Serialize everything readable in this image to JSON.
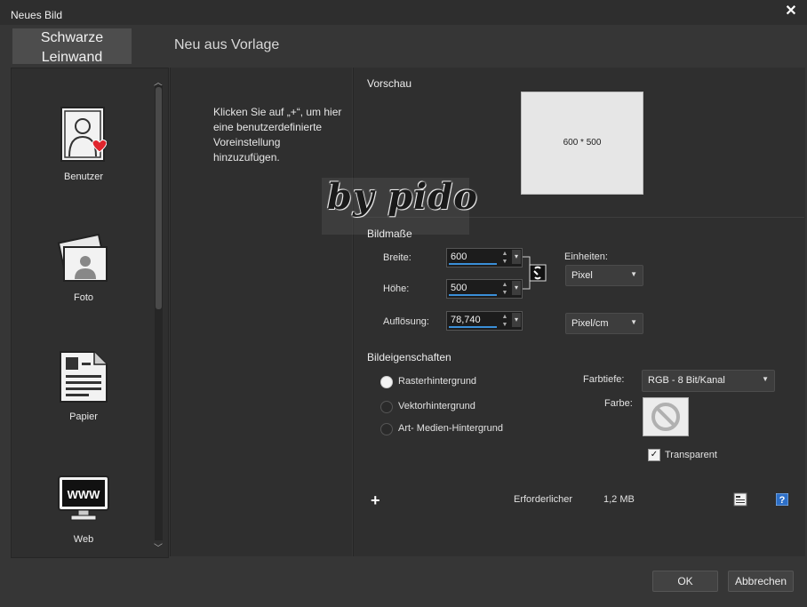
{
  "window": {
    "title": "Neues Bild"
  },
  "tabs": [
    {
      "label_line1": "Schwarze",
      "label_line2": "Leinwand"
    },
    {
      "label": "Neu aus Vorlage"
    }
  ],
  "categories": [
    {
      "label": "Benutzer",
      "icon": "user-icon"
    },
    {
      "label": "Foto",
      "icon": "photo-icon"
    },
    {
      "label": "Papier",
      "icon": "document-icon"
    },
    {
      "label": "Web",
      "icon": "web-monitor-icon"
    }
  ],
  "hint": "Klicken Sie auf „+“, um hier eine benutzerdefinierte Voreinstellung hinzuzufügen.",
  "watermark": "by pido",
  "preview": {
    "heading": "Vorschau",
    "size_label": "600 * 500"
  },
  "dimensions": {
    "heading": "Bildmaße",
    "width_label": "Breite:",
    "width_value": "600",
    "height_label": "Höhe:",
    "height_value": "500",
    "resolution_label": "Auflösung:",
    "resolution_value": "78,740",
    "units_label": "Einheiten:",
    "units_value": "Pixel",
    "resolution_unit": "Pixel/cm"
  },
  "properties": {
    "heading": "Bildeigenschaften",
    "options": [
      {
        "label": "Rasterhintergrund",
        "selected": true
      },
      {
        "label": "Vektorhintergrund",
        "selected": false
      },
      {
        "label": "Art- Medien-Hintergrund",
        "selected": false
      }
    ],
    "depth_label": "Farbtiefe:",
    "depth_value": "RGB - 8 Bit/Kanal",
    "color_label": "Farbe:",
    "transparent_label": "Transparent",
    "transparent_checked": true
  },
  "footer": {
    "required_label": "Erforderlicher",
    "required_value": "1,2 MB",
    "ok_label": "OK",
    "cancel_label": "Abbrechen"
  }
}
